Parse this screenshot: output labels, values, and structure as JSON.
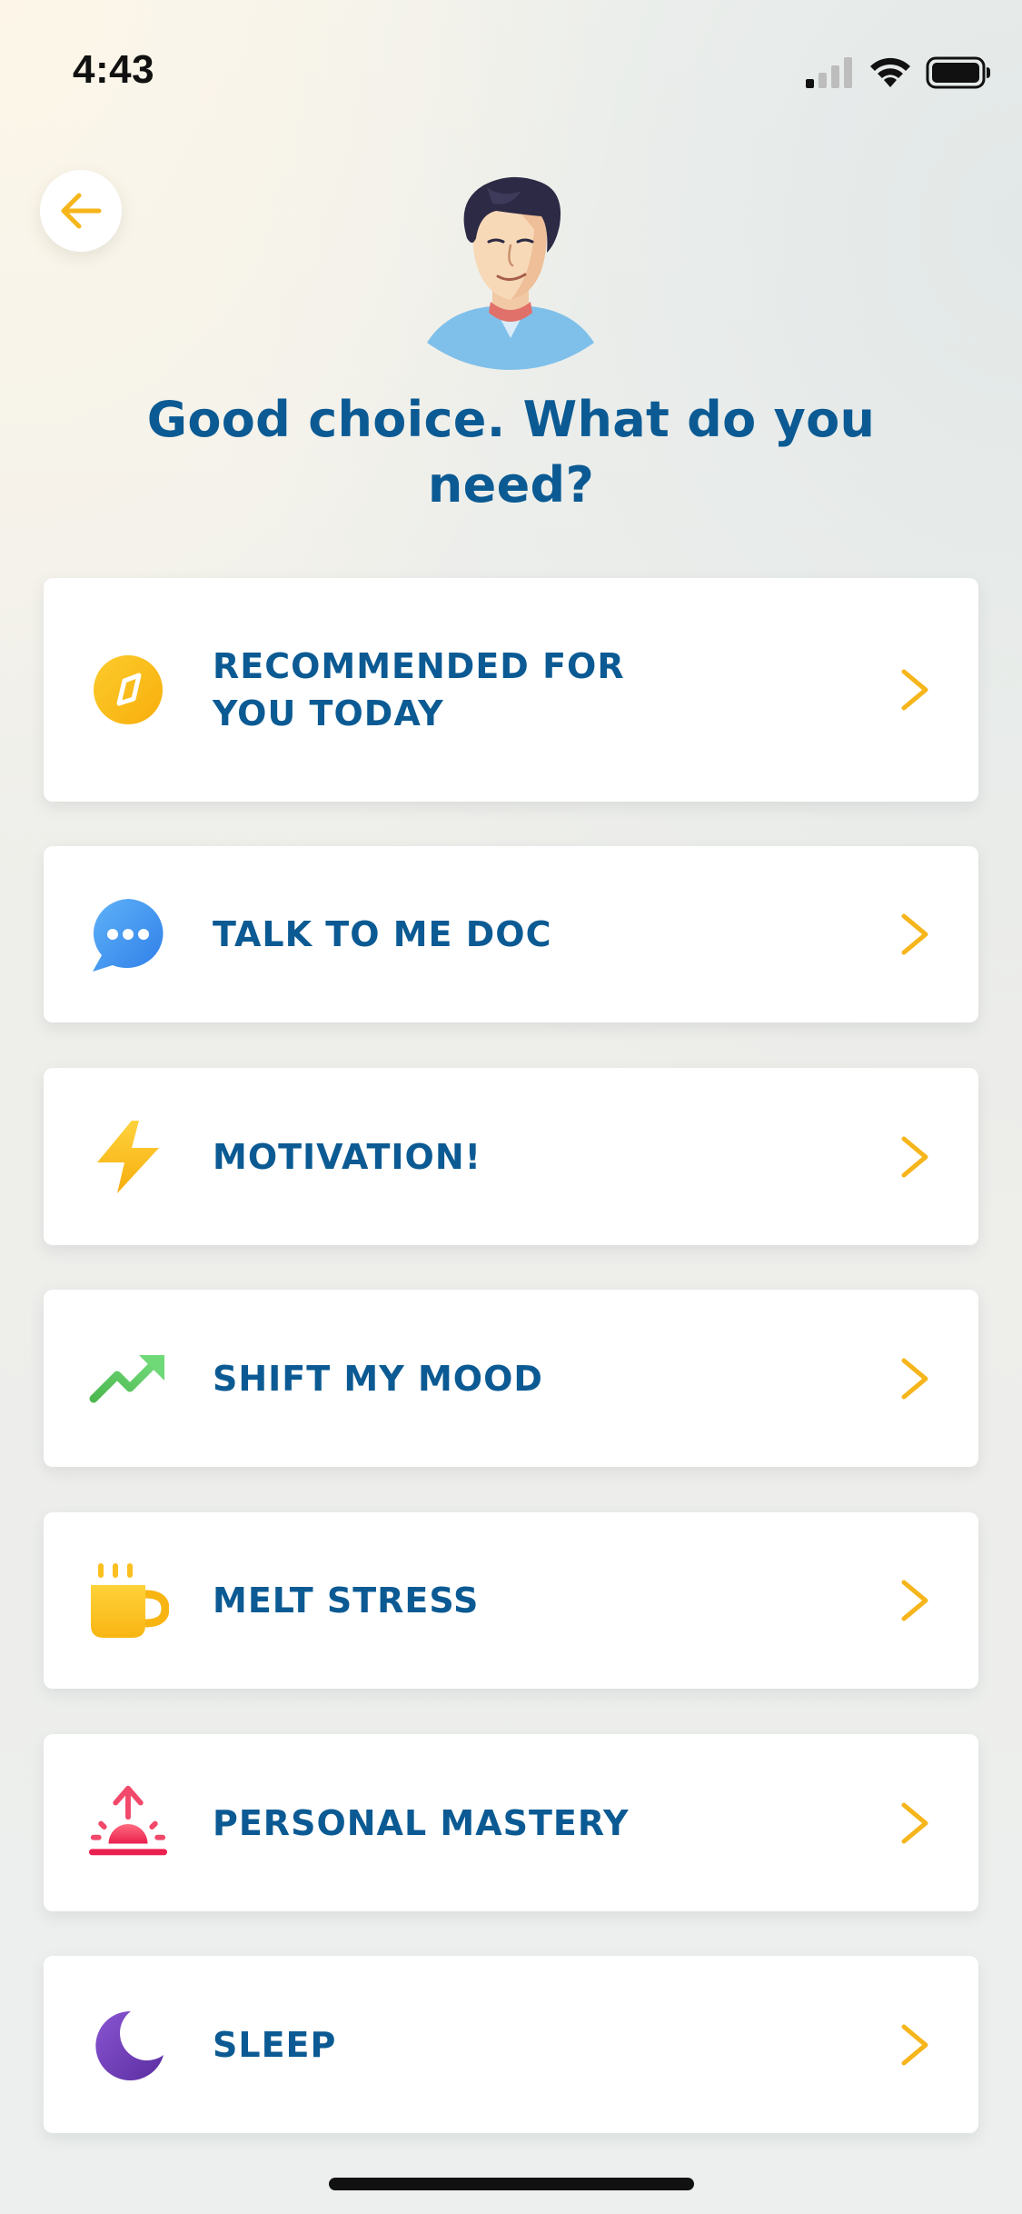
{
  "status_bar": {
    "time": "4:43",
    "icons": [
      "cellular-signal-icon",
      "wifi-icon",
      "battery-icon"
    ]
  },
  "header": {
    "back_icon": "arrow-left-icon",
    "avatar": "doctor-avatar",
    "headline": "Good choice. What do you need?"
  },
  "menu": {
    "items": [
      {
        "label": "RECOMMENDED FOR\nYOU TODAY",
        "icon": "compass-icon",
        "icon_color": "#f9b90f"
      },
      {
        "label": "TALK TO ME DOC",
        "icon": "chat-bubble-icon",
        "icon_color": "#3d8ff0"
      },
      {
        "label": "MOTIVATION!",
        "icon": "lightning-bolt-icon",
        "icon_color": "#fbbb1c"
      },
      {
        "label": "SHIFT MY MOOD",
        "icon": "trending-up-icon",
        "icon_color": "#4bbf5a"
      },
      {
        "label": "MELT STRESS",
        "icon": "coffee-mug-icon",
        "icon_color": "#fbbf1f"
      },
      {
        "label": "PERSONAL MASTERY",
        "icon": "sunrise-icon",
        "icon_color": "#ef2e5c"
      },
      {
        "label": "SLEEP",
        "icon": "moon-icon",
        "icon_color": "#6a3bb0"
      }
    ],
    "chevron_icon": "chevron-right-icon",
    "chevron_color": "#f6b51b"
  },
  "colors": {
    "headline": "#0b5a93",
    "accent": "#f6b51b"
  }
}
